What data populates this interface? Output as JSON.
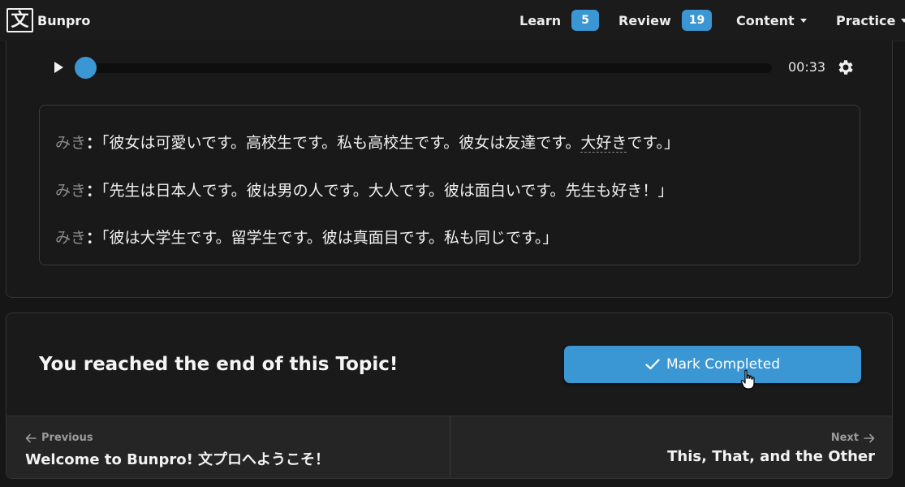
{
  "nav": {
    "logo_glyph": "文",
    "brand": "Bunpro",
    "learn_label": "Learn",
    "learn_count": "5",
    "review_label": "Review",
    "review_count": "19",
    "content_label": "Content",
    "practice_label": "Practice",
    "accent": "#3b97d3"
  },
  "audio": {
    "time": "00:33",
    "progress_fraction": 0.0
  },
  "dialogue": [
    {
      "speaker": "みき",
      "colon": "：",
      "text_a": "「彼女は可愛いです。高校生です。私も高校生です。彼女は友達です。",
      "text_u": "大好き",
      "text_b": "です。」"
    },
    {
      "speaker": "みき",
      "colon": "：",
      "text": "「先生は日本人です。彼は男の人です。大人です。彼は面白いです。先生も好き！」"
    },
    {
      "speaker": "みき",
      "colon": "：",
      "text": "「彼は大学生です。留学生です。彼は真面目です。私も同じです。」"
    }
  ],
  "end": {
    "title": "You reached the end of this Topic!",
    "mark_label": "Mark Completed"
  },
  "pager": {
    "prev_label": "Previous",
    "prev_title": "Welcome to Bunpro! 文プロへようこそ！",
    "next_label": "Next",
    "next_title": "This, That, and the Other"
  }
}
